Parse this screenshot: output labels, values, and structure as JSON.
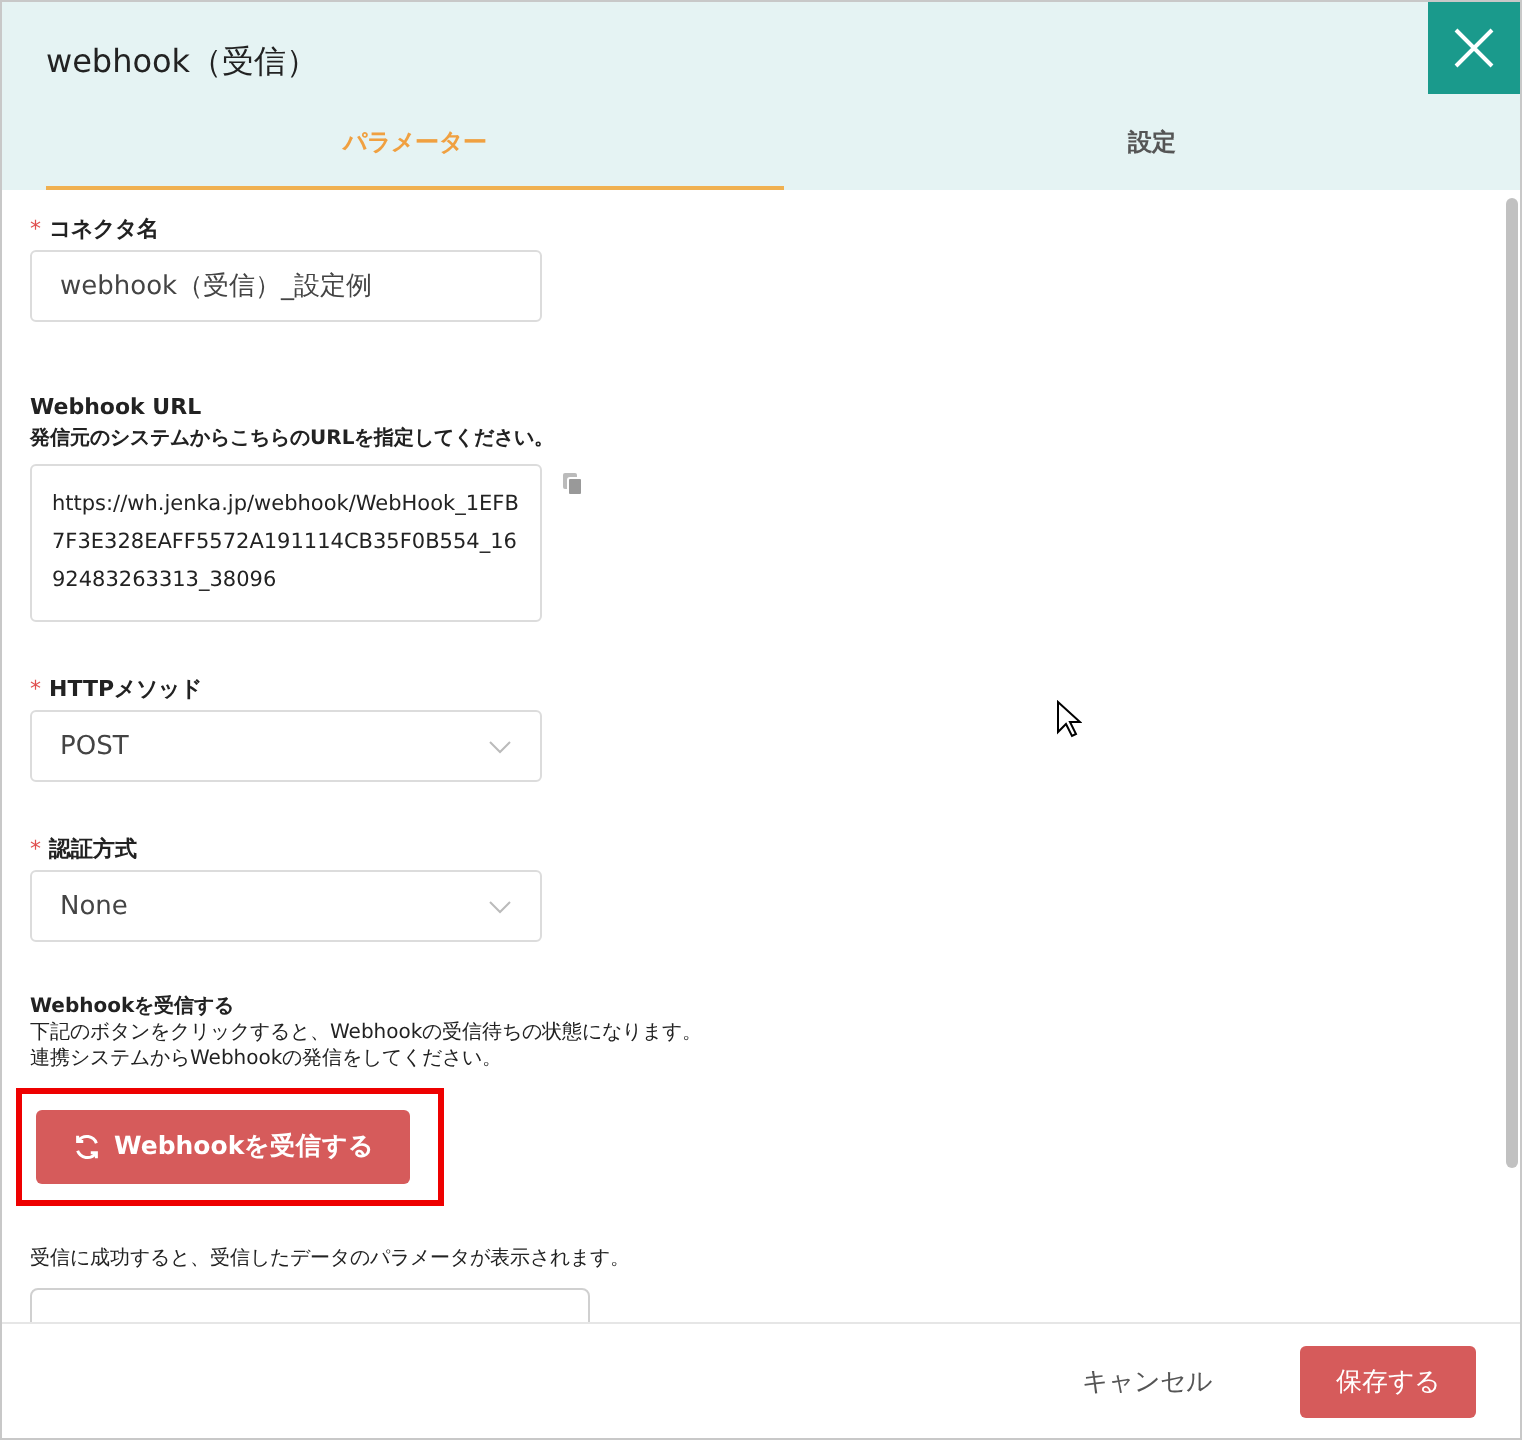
{
  "dialog": {
    "title": "webhook（受信）"
  },
  "tabs": [
    {
      "label": "パラメーター",
      "selected": true
    },
    {
      "label": "設定",
      "selected": false
    }
  ],
  "form": [
    {
      "kind": "input",
      "required_mark": "*",
      "label": "コネクタ名",
      "value": "webhook（受信）_設定例"
    },
    {
      "kind": "url",
      "label": "Webhook URL",
      "hint": "発信元のシステムからこちらのURLを指定してください。",
      "value": "https://wh.jenka.jp/webhook/WebHook_1EFB7F3E328EAFF5572A191114CB35F0B554_1692483263313_38096"
    },
    {
      "kind": "select",
      "required_mark": "*",
      "label": "HTTPメソッド",
      "value": "POST"
    },
    {
      "kind": "select",
      "required_mark": "*",
      "label": "認証方式",
      "value": "None"
    },
    {
      "kind": "action",
      "label": "Webhookを受信する",
      "lines": [
        "下記のボタンをクリックすると、Webhookの受信待ちの状態になります。",
        "連携システムからWebhookの発信をしてください。"
      ],
      "button": "Webhookを受信する",
      "highlighted": true
    },
    {
      "kind": "output",
      "hint": "受信に成功すると、受信したデータのパラメータが表示されます。"
    }
  ],
  "footer": {
    "cancel": "キャンセル",
    "save": "保存する"
  }
}
